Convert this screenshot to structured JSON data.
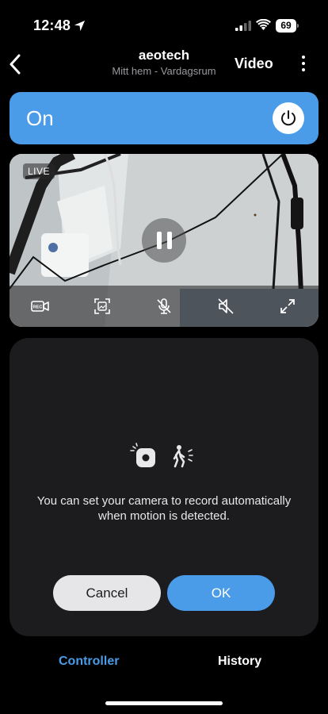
{
  "status_bar": {
    "time": "12:48",
    "battery": "69"
  },
  "nav": {
    "title": "aeotech",
    "subtitle": "Mitt hem - Vardagsrum",
    "video_label": "Video"
  },
  "device": {
    "state_label": "On",
    "accent_color": "#4a9be8"
  },
  "video": {
    "live_label": "LIVE",
    "controls": [
      "record-video-icon",
      "snapshot-icon",
      "mic-muted-icon",
      "speaker-muted-icon",
      "fullscreen-icon"
    ]
  },
  "motion_card": {
    "message": "You can set your camera to record automatically when motion is detected.",
    "cancel_label": "Cancel",
    "ok_label": "OK"
  },
  "tabs": {
    "controller": "Controller",
    "history": "History"
  }
}
